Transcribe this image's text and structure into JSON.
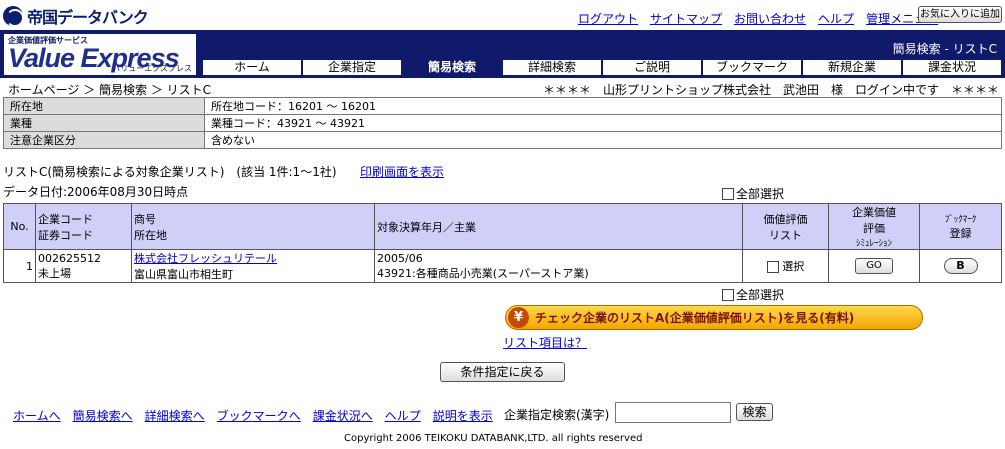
{
  "header": {
    "logo_text": "帝国データバンク",
    "top_links": [
      "ログアウト",
      "サイトマップ",
      "お問い合わせ",
      "ヘルプ",
      "管理メニュー"
    ],
    "favorite_button": "お気に入りに追加"
  },
  "banner": {
    "logo_small": "企業価値評価サービス",
    "logo_main": "Value Express",
    "logo_sub": "バリューエクスプレス",
    "page_label": "簡易検索 - リストC",
    "nav_tabs": [
      {
        "label": "ホーム",
        "active": false
      },
      {
        "label": "企業指定",
        "active": false
      },
      {
        "label": "簡易検索",
        "active": true
      },
      {
        "label": "詳細検索",
        "active": false
      },
      {
        "label": "ご説明",
        "active": false
      },
      {
        "label": "ブックマーク",
        "active": false
      },
      {
        "label": "新規企業",
        "active": false
      },
      {
        "label": "課金状況",
        "active": false
      }
    ]
  },
  "breadcrumb": "ホームページ ＞ 簡易検索 ＞ リストC",
  "login_info": "＊＊＊＊　山形プリントショップ株式会社　武池田　様　ログイン中です　＊＊＊＊",
  "conditions": [
    {
      "key": "所在地",
      "value": "所在地コード：16201 〜 16201"
    },
    {
      "key": "業種",
      "value": "業種コード：43921 〜 43921"
    },
    {
      "key": "注意企業区分",
      "value": "含めない"
    }
  ],
  "list_info": "リストC(簡易検索による対象企業リスト)　(該当 1件:1〜1社)",
  "print_link": "印刷画面を表示",
  "data_date": "データ日付:2006年08月30日時点",
  "select_all": "全部選択",
  "result_table": {
    "headers": {
      "no": "No.",
      "code": [
        "企業コード",
        "証券コード"
      ],
      "name": [
        "商号",
        "所在地"
      ],
      "period": "対象決算年月／主業",
      "valuation_list": [
        "価値評価",
        "リスト"
      ],
      "simulation": [
        "企業価値",
        "評価",
        "ｼﾐｭﾚｰｼｮﾝ"
      ],
      "bookmark": [
        "ﾌﾞｯｸﾏｰｸ",
        "登録"
      ]
    },
    "rows": [
      {
        "no": "1",
        "company_code": "002625512",
        "listing": "未上場",
        "company_name": "株式会社フレッシュリテール",
        "address": "富山県富山市相生町",
        "period": "2005/06",
        "business": "43921:各種商品小売業(スーパーストア業)",
        "select_label": "選択",
        "go_label": "GO",
        "bookmark_label": "B"
      }
    ]
  },
  "yen_button": {
    "icon": "¥",
    "label": "チェック企業のリストA(企業価値評価リスト)を見る(有料)"
  },
  "list_item_link": "リスト項目は？",
  "back_button": "条件指定に戻る",
  "footer_links": [
    "ホームへ",
    "簡易検索へ",
    "詳細検索へ",
    "ブックマークへ",
    "課金状況へ",
    "ヘルプ",
    "説明を表示"
  ],
  "search": {
    "label": "企業指定検索(漢字)",
    "value": "",
    "button": "検索"
  },
  "copyright": "Copyright 2006 TEIKOKU DATABANK,LTD. all rights reserved"
}
